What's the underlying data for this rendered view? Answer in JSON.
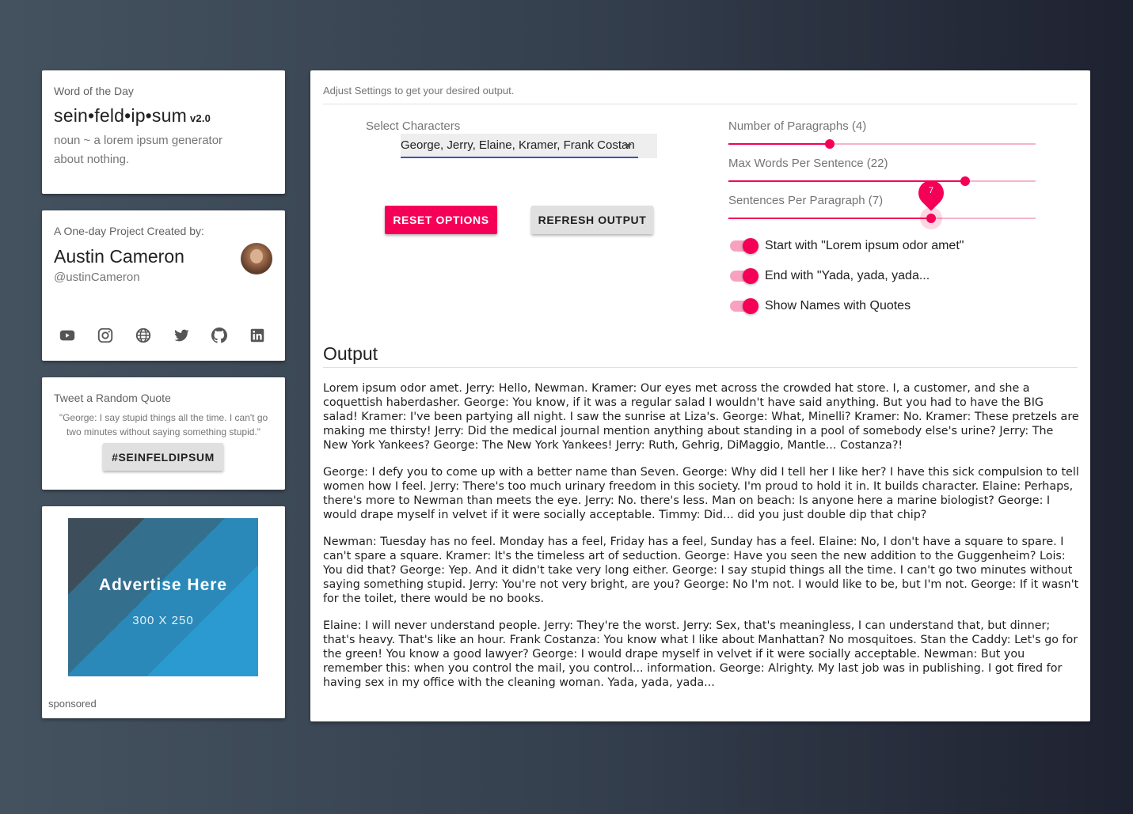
{
  "word_card": {
    "caption": "Word of the Day",
    "title": "sein•feld•ip•sum",
    "version": "v2.0",
    "definition": "noun ~ a lorem ipsum generator about nothing."
  },
  "author_card": {
    "caption": "A One-day Project Created by:",
    "name": "Austin Cameron",
    "handle": "@ustinCameron",
    "social_icons": [
      "youtube-icon",
      "instagram-icon",
      "globe-icon",
      "twitter-icon",
      "github-icon",
      "linkedin-icon"
    ]
  },
  "tweet_card": {
    "caption": "Tweet a Random Quote",
    "quote": "\"George: I say stupid things all the time. I can't go two minutes without saying something stupid.\"",
    "button": "#SEINFELDIPSUM"
  },
  "ad_card": {
    "title": "Advertise Here",
    "size": "300 X 250",
    "sponsored": "sponsored"
  },
  "main": {
    "caption": "Adjust Settings to get your desired output.",
    "select_label": "Select Characters",
    "select_value": "George, Jerry, Elaine, Kramer, Frank Costanza",
    "reset_button": "RESET OPTIONS",
    "refresh_button": "REFRESH OUTPUT",
    "sliders": [
      {
        "label": "Number of Paragraphs (4)",
        "value": 4,
        "fraction": 0.33
      },
      {
        "label": "Max Words Per Sentence (22)",
        "value": 22,
        "fraction": 0.77
      },
      {
        "label": "Sentences Per Paragraph (7)",
        "value": 7,
        "fraction": 0.66,
        "pin": "7"
      }
    ],
    "switches": [
      {
        "label": "Start with \"Lorem ipsum odor amet\"",
        "on": true
      },
      {
        "label": "End with \"Yada, yada, yada...",
        "on": true
      },
      {
        "label": "Show Names with Quotes",
        "on": true
      }
    ],
    "output_title": "Output",
    "paragraphs": [
      "Lorem ipsum odor amet. Jerry: Hello, Newman. Kramer: Our eyes met across the crowded hat store. I, a customer, and she a coquettish haberdasher. George: You know, if it was a regular salad I wouldn't have said anything. But you had to have the BIG salad! Kramer: I've been partying all night. I saw the sunrise at Liza's. George: What, Minelli? Kramer: No. Kramer: These pretzels are making me thirsty! Jerry: Did the medical journal mention anything about standing in a pool of somebody else's urine? Jerry: The New York Yankees? George: The New York Yankees! Jerry: Ruth, Gehrig, DiMaggio, Mantle... Costanza?!",
      "George: I defy you to come up with a better name than Seven. George: Why did I tell her I like her? I have this sick compulsion to tell women how I feel. Jerry: There's too much urinary freedom in this society. I'm proud to hold it in. It builds character. Elaine: Perhaps, there's more to Newman than meets the eye. Jerry: No. there's less. Man on beach: Is anyone here a marine biologist? George: I would drape myself in velvet if it were socially acceptable. Timmy: Did... did you just double dip that chip?",
      "Newman: Tuesday has no feel. Monday has a feel, Friday has a feel, Sunday has a feel. Elaine: No, I don't have a square to spare. I can't spare a square. Kramer: It's the timeless art of seduction. George: Have you seen the new addition to the Guggenheim? Lois: You did that? George: Yep. And it didn't take very long either. George: I say stupid things all the time. I can't go two minutes without saying something stupid. Jerry: You're not very bright, are you? George: No I'm not. I would like to be, but I'm not. George: If it wasn't for the toilet, there would be no books.",
      "Elaine: I will never understand people. Jerry: They're the worst. Jerry: Sex, that's meaningless, I can understand that, but dinner; that's heavy. That's like an hour. Frank Costanza: You know what I like about Manhattan? No mosquitoes. Stan the Caddy: Let's go for the green! You know a good lawyer? George: I would drape myself in velvet if it were socially acceptable. Newman: But you remember this: when you control the mail, you control... information. George: Alrighty. My last job was in publishing. I got fired for having sex in my office with the cleaning woman. Yada, yada, yada..."
    ]
  },
  "colors": {
    "accent": "#f50057",
    "accent_light": "#f8b4ca",
    "select_underline": "#3f51b5"
  }
}
